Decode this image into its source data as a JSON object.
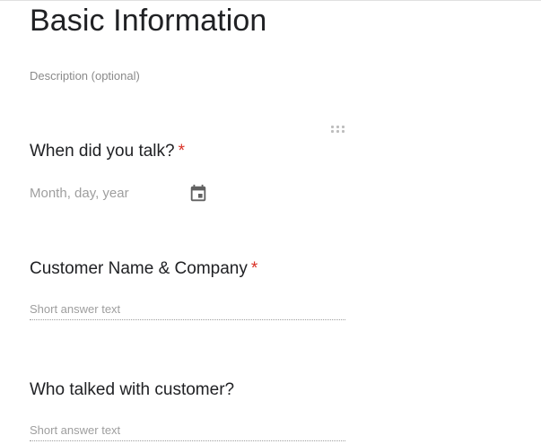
{
  "section": {
    "title": "Basic Information",
    "description_placeholder": "Description (optional)"
  },
  "questions": [
    {
      "title": "When did you talk?",
      "required": true,
      "required_mark": "*",
      "type": "date",
      "placeholder": "Month, day, year",
      "icon": "calendar-icon"
    },
    {
      "title": "Customer Name & Company",
      "required": true,
      "required_mark": "*",
      "type": "short-answer",
      "placeholder": "Short answer text"
    },
    {
      "title": "Who talked with customer?",
      "required": false,
      "type": "short-answer",
      "placeholder": "Short answer text"
    }
  ],
  "colors": {
    "required_star": "#d93025",
    "placeholder_text": "#9e9e9e",
    "title_text": "#202124"
  }
}
